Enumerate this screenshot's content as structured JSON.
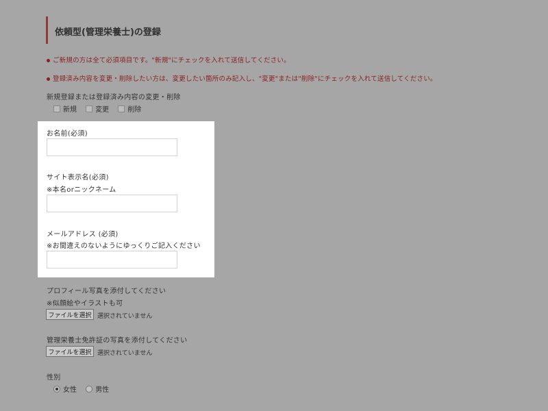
{
  "page": {
    "title": "依頼型(管理栄養士)の登録"
  },
  "notes": [
    "ご新規の方は全て必須項目です。\"新規\"にチェックを入れて送信してください。",
    "登録済み内容を変更・削除したい方は、変更したい箇所のみ記入し、\"変更\"または\"削除\"にチェックを入れて送信してください。"
  ],
  "action": {
    "label": "新規登録または登録済み内容の変更・削除",
    "options": [
      "新規",
      "変更",
      "削除"
    ]
  },
  "name_field": {
    "label": "お名前(必須)",
    "value": ""
  },
  "display_name_field": {
    "label": "サイト表示名(必須)",
    "hint": "※本名orニックネーム",
    "value": ""
  },
  "email_field": {
    "label": "メールアドレス (必須)",
    "hint": "※お間違えのないようにゆっくりご記入ください",
    "value": ""
  },
  "profile_photo": {
    "label": "プロフィール写真を添付してください",
    "hint": "※似顔絵やイラストも可",
    "button": "ファイルを選択",
    "status": "選択されていません"
  },
  "license_photo": {
    "label": "管理栄養士免許証の写真を添付してください",
    "button": "ファイルを選択",
    "status": "選択されていません"
  },
  "gender": {
    "label": "性別",
    "options": [
      "女性",
      "男性"
    ],
    "selected": "女性"
  },
  "colors": {
    "background": "#a6a6a6",
    "accent": "#8e3a35",
    "note_text": "#8a1f1f",
    "panel": "#ffffff"
  }
}
